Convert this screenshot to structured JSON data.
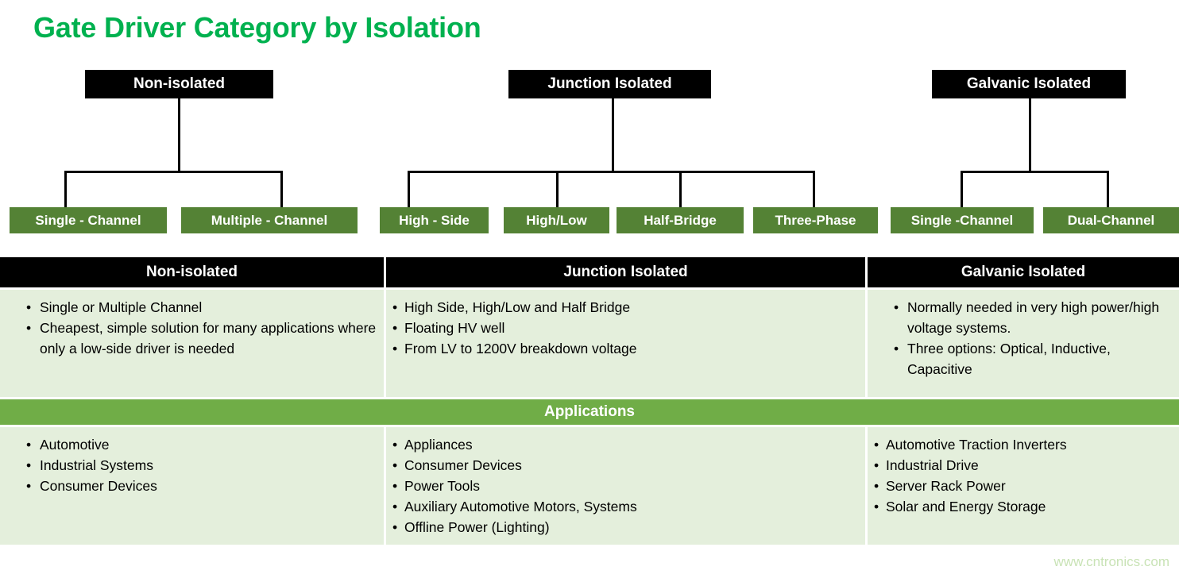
{
  "title": "Gate Driver Category by Isolation",
  "colors": {
    "title_green": "#00B14F",
    "leaf_green": "#548235",
    "applications_green": "#70AD47",
    "cell_green": "#E4EFDC",
    "header_black": "#000000",
    "watermark_green": "#C9E3B6"
  },
  "tree": {
    "groups": [
      {
        "root_label": "Non-isolated",
        "leaves": [
          "Single - Channel",
          "Multiple - Channel"
        ]
      },
      {
        "root_label": "Junction Isolated",
        "leaves": [
          "High - Side",
          "High/Low",
          "Half-Bridge",
          "Three-Phase"
        ]
      },
      {
        "root_label": "Galvanic Isolated",
        "leaves": [
          "Single -Channel",
          "Dual-Channel"
        ]
      }
    ]
  },
  "matrix": {
    "headers": [
      "Non-isolated",
      "Junction Isolated",
      "Galvanic Isolated"
    ],
    "features": [
      [
        "Single or Multiple Channel",
        "Cheapest, simple solution for many applications where only a low-side driver is needed"
      ],
      [
        "High Side, High/Low and Half Bridge",
        "Floating HV well",
        "From LV to 1200V breakdown voltage"
      ],
      [
        "Normally needed in very high power/high voltage systems.",
        "Three options: Optical, Inductive, Capacitive"
      ]
    ],
    "applications_label": "Applications",
    "applications": [
      [
        "Automotive",
        "Industrial Systems",
        "Consumer Devices"
      ],
      [
        "Appliances",
        "Consumer Devices",
        "Power Tools",
        "Auxiliary Automotive Motors, Systems",
        "Offline Power (Lighting)"
      ],
      [
        "Automotive Traction Inverters",
        "Industrial Drive",
        "Server Rack Power",
        "Solar and Energy Storage"
      ]
    ]
  },
  "watermark": "www.cntronics.com"
}
